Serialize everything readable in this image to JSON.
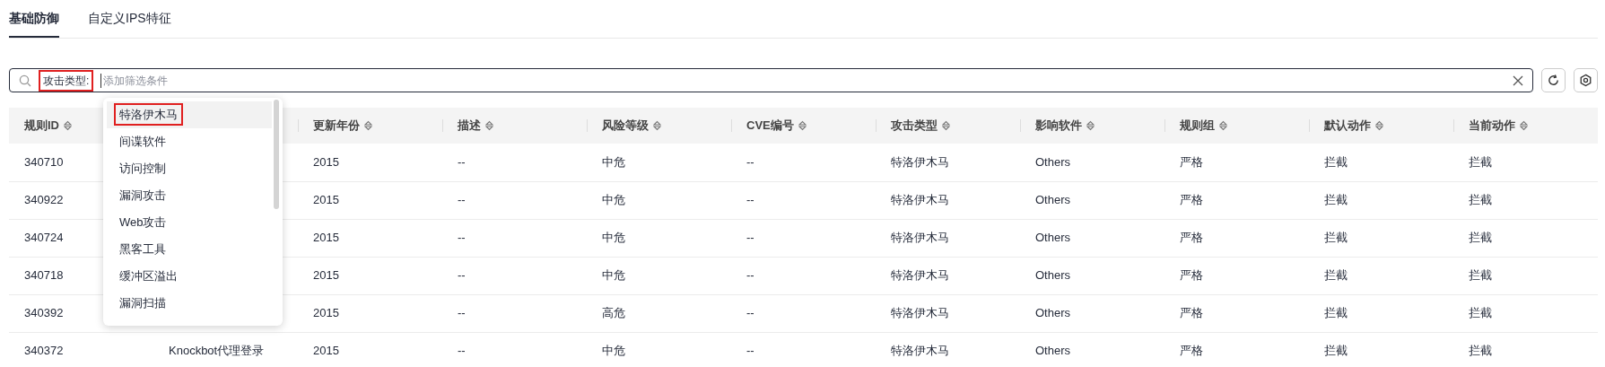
{
  "tabs": [
    {
      "label": "基础防御",
      "selected": true
    },
    {
      "label": "自定义IPS特征",
      "selected": false
    }
  ],
  "filter": {
    "tag": "攻击类型:",
    "tag_highlighted": true,
    "placeholder": "添加筛选条件"
  },
  "dropdown": {
    "items": [
      {
        "label": "特洛伊木马",
        "selected": true,
        "highlighted": true
      },
      {
        "label": "间谍软件",
        "selected": false,
        "highlighted": false
      },
      {
        "label": "访问控制",
        "selected": false,
        "highlighted": false
      },
      {
        "label": "漏洞攻击",
        "selected": false,
        "highlighted": false
      },
      {
        "label": "Web攻击",
        "selected": false,
        "highlighted": false
      },
      {
        "label": "黑客工具",
        "selected": false,
        "highlighted": false
      },
      {
        "label": "缓冲区溢出",
        "selected": false,
        "highlighted": false
      },
      {
        "label": "漏洞扫描",
        "selected": false,
        "highlighted": false
      }
    ]
  },
  "table": {
    "columns": [
      {
        "label": "规则ID"
      },
      {},
      {
        "label": "更新年份"
      },
      {
        "label": "描述"
      },
      {
        "label": "风险等级"
      },
      {
        "label": "CVE编号"
      },
      {
        "label": "攻击类型"
      },
      {
        "label": "影响软件"
      },
      {
        "label": "规则组"
      },
      {
        "label": "默认动作"
      },
      {
        "label": "当前动作"
      }
    ],
    "rows": [
      [
        "340710",
        null,
        "2015",
        "--",
        "中危",
        "--",
        "特洛伊木马",
        "Others",
        "严格",
        "拦截",
        "拦截"
      ],
      [
        "340922",
        null,
        "2015",
        "--",
        "中危",
        "--",
        "特洛伊木马",
        "Others",
        "严格",
        "拦截",
        "拦截"
      ],
      [
        "340724",
        null,
        "2015",
        "--",
        "中危",
        "--",
        "特洛伊木马",
        "Others",
        "严格",
        "拦截",
        "拦截"
      ],
      [
        "340718",
        null,
        "2015",
        "--",
        "中危",
        "--",
        "特洛伊木马",
        "Others",
        "严格",
        "拦截",
        "拦截"
      ],
      [
        "340392",
        null,
        "2015",
        "--",
        "高危",
        "--",
        "特洛伊木马",
        "Others",
        "严格",
        "拦截",
        "拦截"
      ],
      [
        "340372",
        "Knockbot代理登录",
        "2015",
        "--",
        "中危",
        "--",
        "特洛伊木马",
        "Others",
        "严格",
        "拦截",
        "拦截"
      ]
    ]
  }
}
